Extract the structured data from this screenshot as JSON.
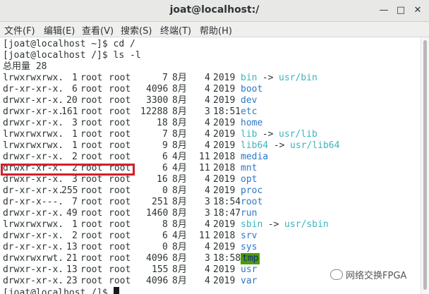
{
  "window": {
    "title": "joat@localhost:/"
  },
  "menu": [
    "文件(F)",
    "编辑(E)",
    "查看(V)",
    "搜索(S)",
    "终端(T)",
    "帮助(H)"
  ],
  "terminal": {
    "lines": [
      {
        "kind": "text",
        "text": "[joat@localhost ~]$ cd /"
      },
      {
        "kind": "text",
        "text": "[joat@localhost /]$ ls -l"
      },
      {
        "kind": "text",
        "text": "总用量 28"
      },
      {
        "kind": "entry",
        "perm": "lrwxrwxrwx.",
        "links": "1",
        "user": "root",
        "group": "root",
        "size": "7",
        "month": "8月",
        "day": "4",
        "time": "2019",
        "name": "bin",
        "name_type": "lnk",
        "target": "usr/bin"
      },
      {
        "kind": "entry",
        "perm": "dr-xr-xr-x.",
        "links": "6",
        "user": "root",
        "group": "root",
        "size": "4096",
        "month": "8月",
        "day": "4",
        "time": "2019",
        "name": "boot",
        "name_type": "dir"
      },
      {
        "kind": "entry",
        "perm": "drwxr-xr-x.",
        "links": "20",
        "user": "root",
        "group": "root",
        "size": "3300",
        "month": "8月",
        "day": "4",
        "time": "2019",
        "name": "dev",
        "name_type": "dir"
      },
      {
        "kind": "entry",
        "perm": "drwxr-xr-x.",
        "links": "161",
        "user": "root",
        "group": "root",
        "size": "12288",
        "month": "8月",
        "day": "3",
        "time": "18:51",
        "name": "etc",
        "name_type": "dir"
      },
      {
        "kind": "entry",
        "perm": "drwxr-xr-x.",
        "links": "3",
        "user": "root",
        "group": "root",
        "size": "18",
        "month": "8月",
        "day": "4",
        "time": "2019",
        "name": "home",
        "name_type": "dir"
      },
      {
        "kind": "entry",
        "perm": "lrwxrwxrwx.",
        "links": "1",
        "user": "root",
        "group": "root",
        "size": "7",
        "month": "8月",
        "day": "4",
        "time": "2019",
        "name": "lib",
        "name_type": "lnk",
        "target": "usr/lib"
      },
      {
        "kind": "entry",
        "perm": "lrwxrwxrwx.",
        "links": "1",
        "user": "root",
        "group": "root",
        "size": "9",
        "month": "8月",
        "day": "4",
        "time": "2019",
        "name": "lib64",
        "name_type": "lnk",
        "target": "usr/lib64"
      },
      {
        "kind": "entry",
        "perm": "drwxr-xr-x.",
        "links": "2",
        "user": "root",
        "group": "root",
        "size": "6",
        "month": "4月",
        "day": "11",
        "time": "2018",
        "name": "media",
        "name_type": "dir"
      },
      {
        "kind": "entry",
        "perm": "drwxr-xr-x.",
        "links": "2",
        "user": "root",
        "group": "root",
        "size": "6",
        "month": "4月",
        "day": "11",
        "time": "2018",
        "name": "mnt",
        "name_type": "dir"
      },
      {
        "kind": "entry",
        "perm": "drwxr-xr-x.",
        "links": "3",
        "user": "root",
        "group": "root",
        "size": "16",
        "month": "8月",
        "day": "4",
        "time": "2019",
        "name": "opt",
        "name_type": "dir"
      },
      {
        "kind": "entry",
        "perm": "dr-xr-xr-x.",
        "links": "255",
        "user": "root",
        "group": "root",
        "size": "0",
        "month": "8月",
        "day": "4",
        "time": "2019",
        "name": "proc",
        "name_type": "dir"
      },
      {
        "kind": "entry",
        "perm": "dr-xr-x---.",
        "links": "7",
        "user": "root",
        "group": "root",
        "size": "251",
        "month": "8月",
        "day": "3",
        "time": "18:54",
        "name": "root",
        "name_type": "dir"
      },
      {
        "kind": "entry",
        "perm": "drwxr-xr-x.",
        "links": "49",
        "user": "root",
        "group": "root",
        "size": "1460",
        "month": "8月",
        "day": "3",
        "time": "18:47",
        "name": "run",
        "name_type": "dir"
      },
      {
        "kind": "entry",
        "perm": "lrwxrwxrwx.",
        "links": "1",
        "user": "root",
        "group": "root",
        "size": "8",
        "month": "8月",
        "day": "4",
        "time": "2019",
        "name": "sbin",
        "name_type": "lnk",
        "target": "usr/sbin"
      },
      {
        "kind": "entry",
        "perm": "drwxr-xr-x.",
        "links": "2",
        "user": "root",
        "group": "root",
        "size": "6",
        "month": "4月",
        "day": "11",
        "time": "2018",
        "name": "srv",
        "name_type": "dir"
      },
      {
        "kind": "entry",
        "perm": "dr-xr-xr-x.",
        "links": "13",
        "user": "root",
        "group": "root",
        "size": "0",
        "month": "8月",
        "day": "4",
        "time": "2019",
        "name": "sys",
        "name_type": "dir"
      },
      {
        "kind": "entry",
        "perm": "drwxrwxrwt.",
        "links": "21",
        "user": "root",
        "group": "root",
        "size": "4096",
        "month": "8月",
        "day": "3",
        "time": "18:58",
        "name": "tmp",
        "name_type": "tmp"
      },
      {
        "kind": "entry",
        "perm": "drwxr-xr-x.",
        "links": "13",
        "user": "root",
        "group": "root",
        "size": "155",
        "month": "8月",
        "day": "4",
        "time": "2019",
        "name": "usr",
        "name_type": "dir"
      },
      {
        "kind": "entry",
        "perm": "drwxr-xr-x.",
        "links": "23",
        "user": "root",
        "group": "root",
        "size": "4096",
        "month": "8月",
        "day": "4",
        "time": "2019",
        "name": "var",
        "name_type": "dir"
      },
      {
        "kind": "prompt",
        "text": "[joat@localhost /]$ "
      }
    ]
  },
  "watermark": "网络交换FPGA",
  "colors": {
    "directory": "#2d78c8",
    "symlink": "#3bb5bd",
    "sticky_bg": "#4e9a06",
    "highlight_box": "#d0202a"
  }
}
